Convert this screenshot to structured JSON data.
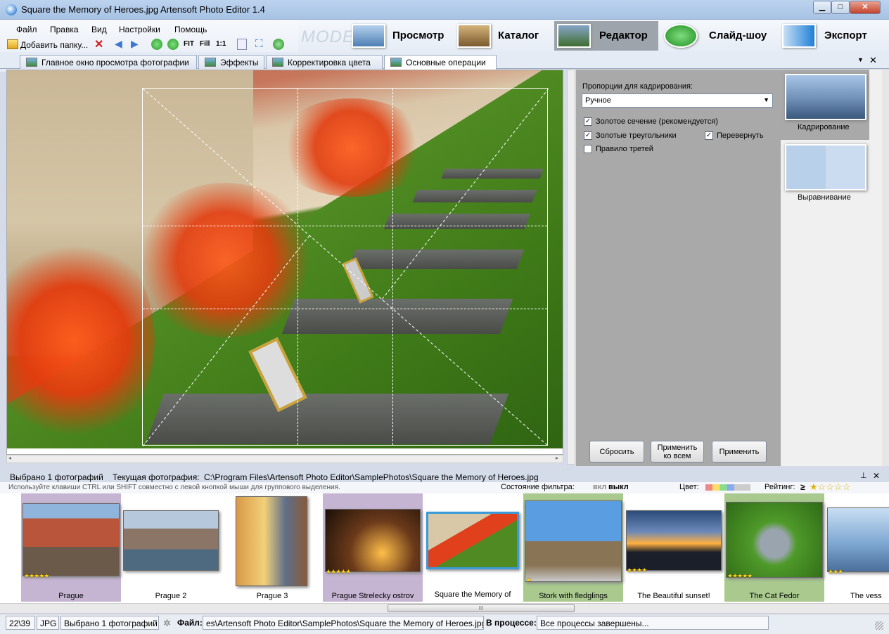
{
  "window": {
    "title": "Square the Memory of Heroes.jpg    Artensoft Photo Editor 1.4",
    "minimize": "▁",
    "maximize": "□",
    "close": "✕"
  },
  "menu": [
    "Файл",
    "Правка",
    "Вид",
    "Настройки",
    "Помощь"
  ],
  "toolbar": {
    "add_folder": "Добавить папку...",
    "fit": "FIT",
    "fill": "Fill",
    "one_to_one": "1:1"
  },
  "mode": {
    "label": "MODE:",
    "buttons": [
      "Просмотр",
      "Каталог",
      "Редактор",
      "Слайд-шоу",
      "Экспорт"
    ],
    "active": "Редактор"
  },
  "tabs": [
    "Главное окно просмотра фотографии",
    "Эффекты",
    "Корректировка цвета",
    "Основные операции"
  ],
  "tab_controls": {
    "dropdown": "▼",
    "close": "✕"
  },
  "crop_panel": {
    "proportions_label": "Пропорции для кадрирования:",
    "proportions_value": "Ручное",
    "golden_section": "Золотое сечение (рекомендуется)",
    "golden_triangles": "Золотые треугольники",
    "flip": "Перевернуть",
    "rule_of_thirds": "Правило третей",
    "reset": "Сбросить",
    "apply_all": "Применить ко всем",
    "apply": "Применить",
    "golden_section_checked": true,
    "golden_triangles_checked": true,
    "flip_checked": true,
    "rule_of_thirds_checked": false
  },
  "side_tools": [
    "Кадрирование",
    "Выравнивание"
  ],
  "info": {
    "selected": "Выбрано 1  фотографий",
    "current_label": "Текущая фотография:",
    "current_path": "C:\\Program Files\\Artensoft Photo Editor\\SamplePhotos\\Square the Memory of Heroes.jpg",
    "pin": "⊥",
    "close": "✕"
  },
  "hint": {
    "text": "Используйте клавиши CTRL или SHIFT совместно с левой кнопкой мыши для группового выделения.",
    "filter_label": "Состояние фильтра:",
    "filter_on": "вкл",
    "filter_off": "выкл",
    "color_label": "Цвет:",
    "rating_label": "Рейтинг:",
    "rating_ge": "≥",
    "rating_stars": "★☆☆☆☆"
  },
  "thumbnails": [
    {
      "caption": "Prague",
      "stars": "★★★★★"
    },
    {
      "caption": "Prague 2",
      "stars": ""
    },
    {
      "caption": "Prague 3",
      "stars": ""
    },
    {
      "caption": "Prague Strelecky ostrov",
      "stars": "★★★★★"
    },
    {
      "caption": "Square the Memory of",
      "stars": ""
    },
    {
      "caption": "Stork with fledglings",
      "stars": "★"
    },
    {
      "caption": "The Beautiful sunset!",
      "stars": "★★★★"
    },
    {
      "caption": "The Cat Fedor",
      "stars": "★★★★★"
    },
    {
      "caption": "The vess",
      "stars": "★★★"
    }
  ],
  "scroll_grip": "III",
  "status": {
    "counter": "22\\39",
    "type": "JPG",
    "selected": "Выбрано 1 фотографий",
    "file_label": "Файл:",
    "file_path": "es\\Artensoft Photo Editor\\SamplePhotos\\Square the Memory of Heroes.jpg",
    "process_label": "В процессе:",
    "process_value": "Все процессы завершены..."
  }
}
